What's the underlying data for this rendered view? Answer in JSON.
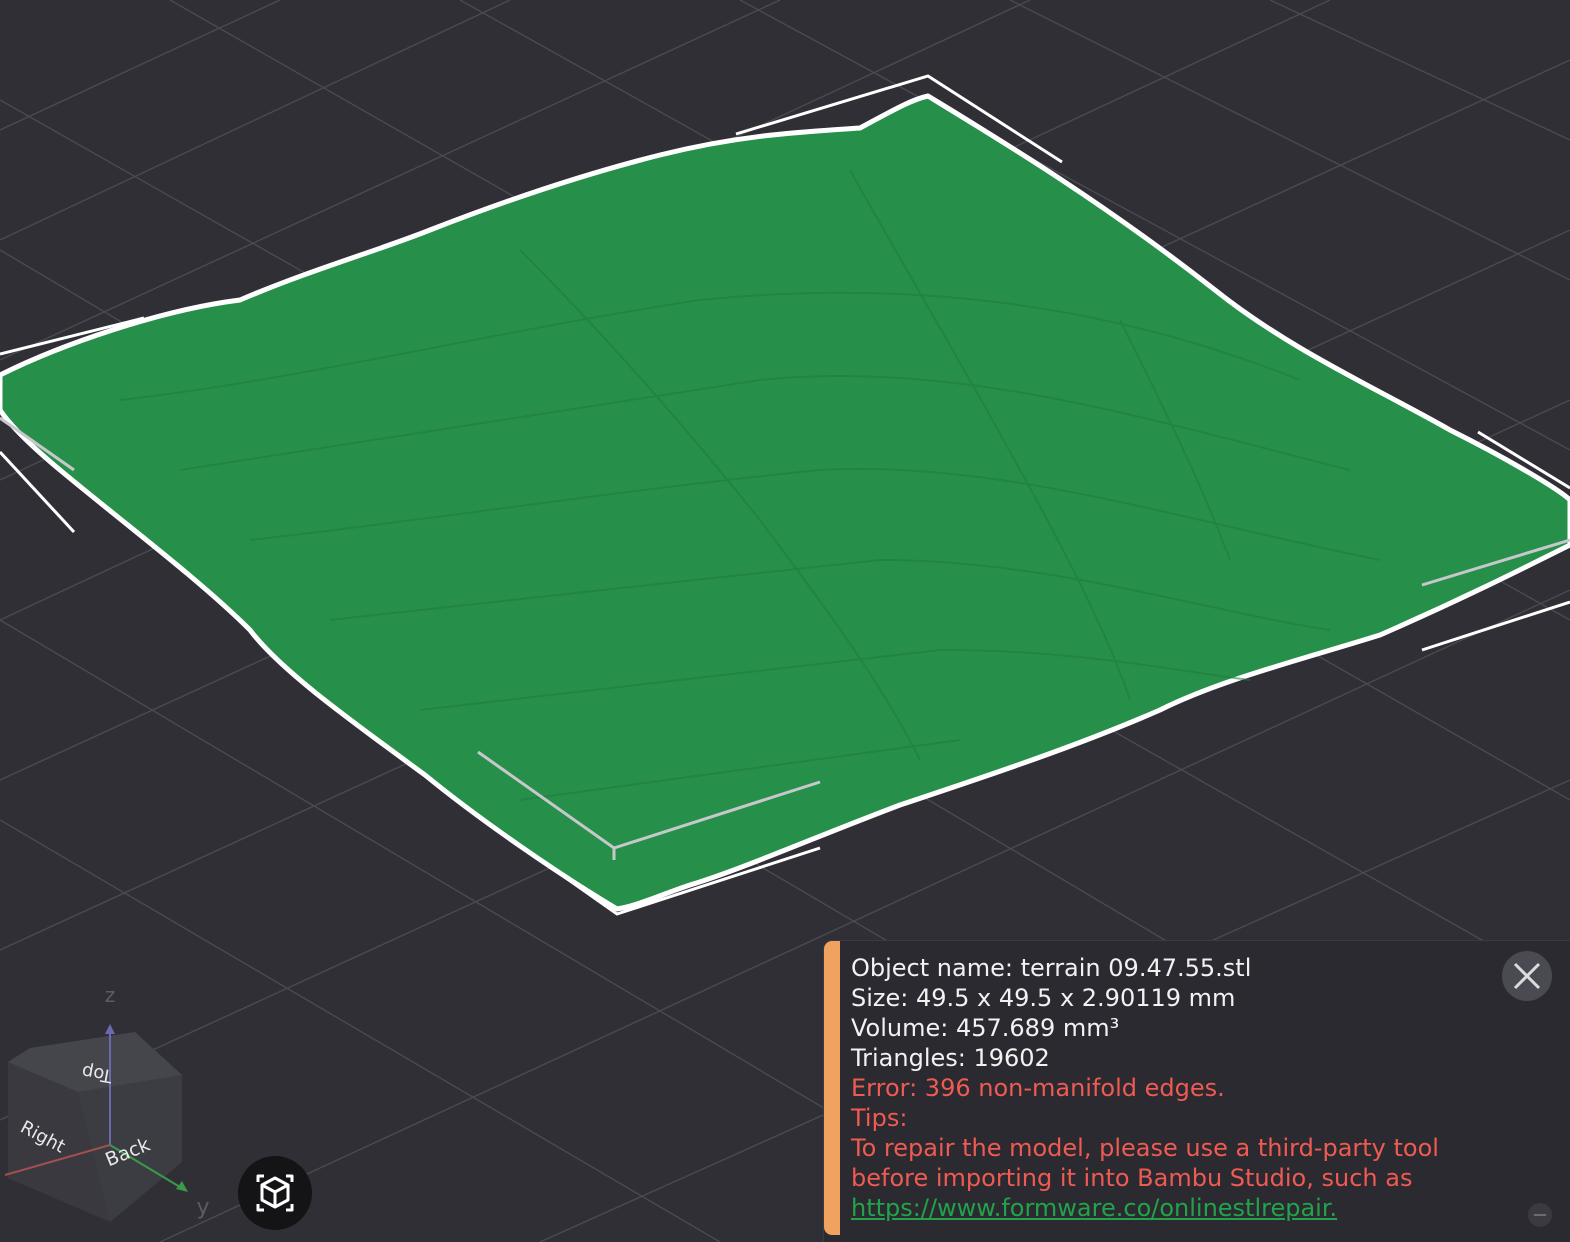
{
  "info_panel": {
    "object_name": "Object name: terrain 09.47.55.stl",
    "size": "Size: 49.5 x 49.5 x 2.90119 mm",
    "volume": "Volume: 457.689 mm³",
    "triangles": "Triangles: 19602",
    "error": "Error: 396 non-manifold edges.",
    "tips_label": "Tips:",
    "tip_line1": "To repair the model, please use a third-party tool",
    "tip_line2": "before importing it into Bambu Studio, such as",
    "repair_link": "https://www.formware.co/onlinestlrepair."
  },
  "view_cube": {
    "top": "Top",
    "right": "Right",
    "back": "Back"
  },
  "axes": {
    "z": "z",
    "y": "y"
  },
  "colors": {
    "background": "#2f2f35",
    "model_fill": "#26904a",
    "model_outline": "#ffffff",
    "accent": "#f0a260",
    "error_text": "#ef5a52",
    "link": "#22a34a"
  },
  "icons": {
    "close": "close-icon",
    "view_toggle": "cube-view-icon",
    "minimize": "minimize-icon"
  }
}
